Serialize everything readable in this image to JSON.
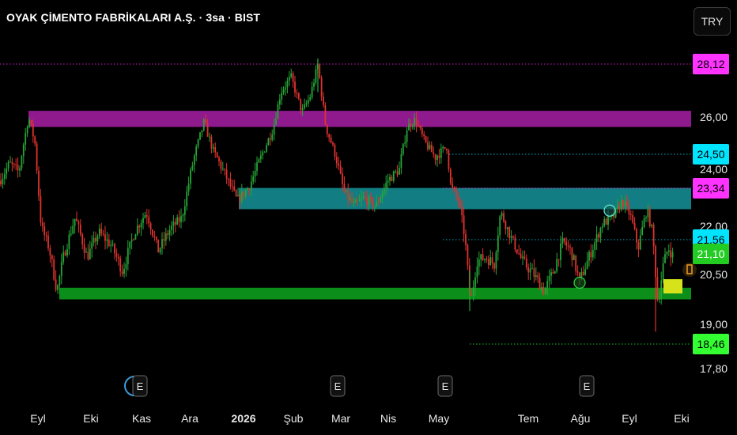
{
  "header": {
    "title": "OYAK ÇİMENTO FABRİKALARI A.Ş. · 3sa · BIST",
    "currency_button": "TRY"
  },
  "chart_data": {
    "type": "candlestick",
    "title": "OYAK ÇİMENTO FABRİKALARI A.Ş. · 3sa · BIST",
    "timeframe": "3sa",
    "exchange": "BIST",
    "currency": "TRY",
    "y_ticks": [
      "26,00",
      "24,00",
      "22,00",
      "20,50",
      "19,00",
      "17,80"
    ],
    "x_ticks": [
      "Eyl",
      "Eki",
      "Kas",
      "Ara",
      "2026",
      "Şub",
      "Mar",
      "Nis",
      "May",
      "Tem",
      "Ağu",
      "Eyl",
      "Eki"
    ],
    "ylim": [
      17.5,
      28.7
    ],
    "price_tags": [
      {
        "label": "28,12",
        "value": 28.12,
        "bg": "#ff33ff",
        "fg": "#000000",
        "line": true
      },
      {
        "label": "24,50",
        "value": 24.5,
        "bg": "#00e5ff",
        "fg": "#000000",
        "line": true
      },
      {
        "label": "23,34",
        "value": 23.34,
        "bg": "#ff33ff",
        "fg": "#000000",
        "line": true
      },
      {
        "label": "21,56",
        "value": 21.56,
        "bg": "#00e5ff",
        "fg": "#000000",
        "line": true
      },
      {
        "label": "21,10",
        "value": 21.1,
        "bg": "#22cc22",
        "fg": "#ffffff",
        "line": false
      },
      {
        "label": "18,46",
        "value": 18.46,
        "bg": "#33ff33",
        "fg": "#000000",
        "line": true
      }
    ],
    "zones": [
      {
        "name": "purple-resistance-zone",
        "from_month": "Eyl",
        "y_top": 26.25,
        "y_bottom": 25.6,
        "color": "#8e1a8e"
      },
      {
        "name": "teal-zone",
        "from_month": "Ara",
        "y_top": 23.35,
        "y_bottom": 22.6,
        "color": "#127d82"
      },
      {
        "name": "green-support-zone",
        "from_month": "Eyl",
        "y_top": 20.1,
        "y_bottom": 19.75,
        "color": "#0b8f1a"
      }
    ],
    "series": [
      {
        "anchors": [
          [
            0,
            23.6
          ],
          [
            12,
            24.2
          ],
          [
            24,
            23.9
          ],
          [
            36,
            26.0
          ],
          [
            44,
            25.0
          ],
          [
            52,
            22.0
          ],
          [
            62,
            21.3
          ],
          [
            72,
            20.0
          ],
          [
            80,
            21.0
          ],
          [
            95,
            22.3
          ],
          [
            110,
            21.0
          ],
          [
            125,
            21.8
          ],
          [
            140,
            21.4
          ],
          [
            155,
            20.6
          ],
          [
            170,
            21.8
          ],
          [
            185,
            22.5
          ],
          [
            200,
            21.2
          ],
          [
            215,
            21.9
          ],
          [
            230,
            22.3
          ],
          [
            242,
            24.0
          ],
          [
            258,
            25.8
          ],
          [
            270,
            24.6
          ],
          [
            285,
            23.8
          ],
          [
            300,
            22.9
          ],
          [
            315,
            23.4
          ],
          [
            330,
            24.4
          ],
          [
            345,
            25.5
          ],
          [
            355,
            27.0
          ],
          [
            368,
            27.6
          ],
          [
            382,
            26.2
          ],
          [
            392,
            26.8
          ],
          [
            402,
            28.1
          ],
          [
            412,
            25.6
          ],
          [
            425,
            24.4
          ],
          [
            435,
            23.2
          ],
          [
            448,
            22.7
          ],
          [
            460,
            23.0
          ],
          [
            475,
            22.7
          ],
          [
            490,
            23.6
          ],
          [
            505,
            24.0
          ],
          [
            515,
            25.6
          ],
          [
            525,
            25.9
          ],
          [
            537,
            25.0
          ],
          [
            550,
            24.4
          ],
          [
            565,
            24.8
          ],
          [
            570,
            23.4
          ],
          [
            580,
            22.9
          ],
          [
            588,
            21.6
          ],
          [
            595,
            19.6
          ],
          [
            603,
            20.9
          ],
          [
            615,
            21.0
          ],
          [
            625,
            20.8
          ],
          [
            633,
            22.5
          ],
          [
            645,
            21.7
          ],
          [
            660,
            20.9
          ],
          [
            675,
            20.5
          ],
          [
            688,
            20.0
          ],
          [
            700,
            20.6
          ],
          [
            712,
            21.5
          ],
          [
            722,
            21.2
          ],
          [
            733,
            20.3
          ],
          [
            748,
            21.2
          ],
          [
            762,
            22.1
          ],
          [
            775,
            22.3
          ],
          [
            787,
            22.9
          ],
          [
            797,
            22.4
          ],
          [
            807,
            21.3
          ],
          [
            818,
            22.6
          ],
          [
            825,
            21.8
          ],
          [
            832,
            19.6
          ],
          [
            838,
            20.7
          ],
          [
            845,
            21.3
          ],
          [
            852,
            21.0
          ]
        ]
      }
    ],
    "markers": [
      {
        "name": "teal-circle",
        "month_index": 11,
        "value": 22.55,
        "color": "#5ee6d0"
      },
      {
        "name": "green-circle",
        "month_index": 10,
        "value": 20.3,
        "color": "#33cc44"
      }
    ],
    "earnings_markers": [
      {
        "label": "E",
        "near": "Kas"
      },
      {
        "label": "E",
        "near": "Mar"
      },
      {
        "label": "E",
        "near": "May"
      },
      {
        "label": "E",
        "near": "Ağu"
      }
    ],
    "grid": false,
    "legend": "none"
  },
  "colors": {
    "background": "#000000",
    "up_candle": "#26a637",
    "down_candle": "#e0332e",
    "axis_text": "#e6e6e6"
  }
}
